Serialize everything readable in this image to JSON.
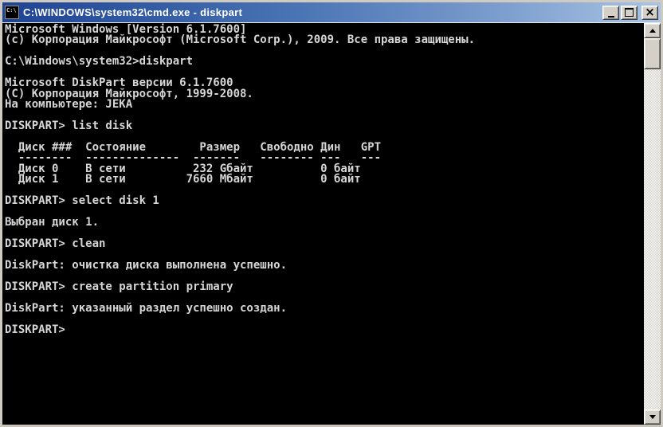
{
  "window": {
    "title": "C:\\WINDOWS\\system32\\cmd.exe - diskpart",
    "icon_label": "C:\\",
    "controls": {
      "minimize": "minimize",
      "maximize": "maximize",
      "close_glyph": "×"
    }
  },
  "colors": {
    "titlebar_gradient_left": "#1e4394",
    "titlebar_gradient_right": "#a9c4e4",
    "chrome": "#d4d0c8",
    "console_background": "#000000",
    "console_text": "#d6d6d6"
  },
  "terminal": {
    "prompt": "DISKPART>",
    "lines": [
      "Microsoft Windows [Version 6.1.7600]",
      "(c) Корпорация Майкрософт (Microsoft Corp.), 2009. Все права защищены.",
      "",
      "C:\\Windows\\system32>diskpart",
      "",
      "Microsoft DiskPart версии 6.1.7600",
      "(C) Корпорация Майкрософт, 1999-2008.",
      "На компьютере: JEKA",
      "",
      "DISKPART> list disk",
      "",
      "  Диск ###  Состояние        Размер   Свободно Дин   GPT",
      "  --------  --------------  -------   -------- ---   ---",
      "  Диск 0    В сети          232 Gбайт          0 байт",
      "  Диск 1    В сети         7660 Мбайт          0 байт",
      "",
      "DISKPART> select disk 1",
      "",
      "Выбран диск 1.",
      "",
      "DISKPART> clean",
      "",
      "DiskPart: очистка диска выполнена успешно.",
      "",
      "DISKPART> create partition primary",
      "",
      "DiskPart: указанный раздел успешно создан.",
      "",
      "DISKPART>"
    ]
  }
}
